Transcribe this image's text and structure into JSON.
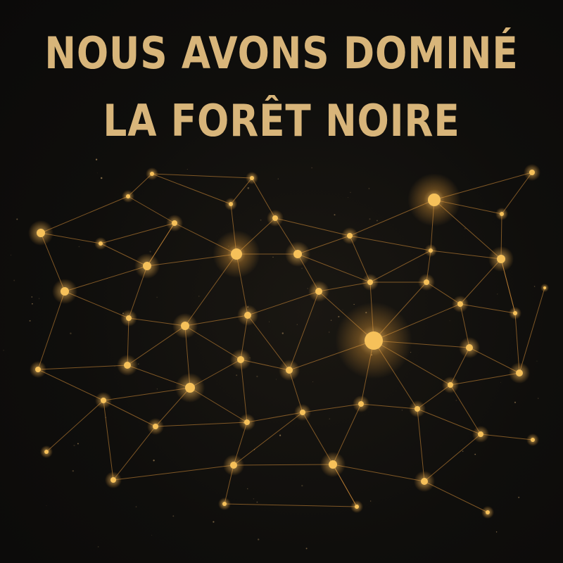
{
  "headline": {
    "line1": "NOUS AVONS DOMINÉ",
    "line2": "LA FORÊT NOIRE"
  },
  "colors": {
    "background": "#0f0e0c",
    "text": "#d8b57a",
    "node": "#f6c15a",
    "edge": "#d9913a"
  }
}
